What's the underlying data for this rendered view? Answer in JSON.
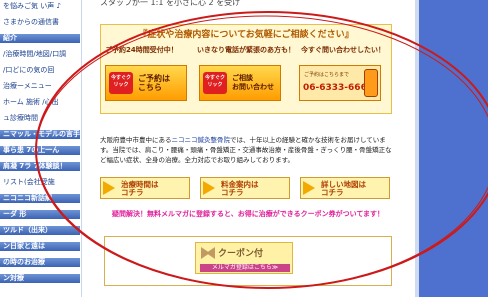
{
  "top_text": "スタッフが一 1:1 を小さに心  2 を受け",
  "sidebar": {
    "items": [
      {
        "label": "を悩みご気   い声 ♪",
        "kind": "link"
      },
      {
        "label": "さまからの通信書",
        "kind": "link"
      },
      {
        "label": "紹介",
        "kind": "head"
      },
      {
        "label": "/治療時間/地図/口調",
        "kind": "link"
      },
      {
        "label": "/口どにの気の回",
        "kind": "link"
      },
      {
        "label": "治療ーメニュー",
        "kind": "link"
      },
      {
        "label": "ホーム 施術 /心出",
        "kind": "link"
      },
      {
        "label": "ュ診療時間",
        "kind": "link"
      },
      {
        "label": "ニマッル・モデルの言手大",
        "kind": "head"
      },
      {
        "label": "事ら患 7の上一ん",
        "kind": "head"
      },
      {
        "label": "肩凝 7ラ 7体験談！",
        "kind": "head"
      },
      {
        "label": "リスト(会社受施",
        "kind": "link"
      },
      {
        "label": "ニコニコ新話解",
        "kind": "head"
      },
      {
        "label": "ーダ 形",
        "kind": "head"
      },
      {
        "label": "ツルド（出来）",
        "kind": "head"
      },
      {
        "label": "ン日家と遠は",
        "kind": "head"
      },
      {
        "label": "の時のお治療",
        "kind": "head"
      },
      {
        "label": "ン対療",
        "kind": "head"
      }
    ]
  },
  "banner": {
    "title": "『症状や治療内容についてお気軽にご相談ください』",
    "captions": [
      "ご予約24時間受付中！",
      "いきなり電話が緊張のあ方も！",
      "今すぐ問い合わせしたい！"
    ],
    "cta_reserve": {
      "badge": "今すぐクリック",
      "label": "ご予約は\nこちら"
    },
    "cta_consult": {
      "badge": "今すぐクリック",
      "label": "ご相談\nお問い合わせ"
    },
    "tel": {
      "small": "ご予約はこちらまで",
      "number": "06-6333-6665"
    }
  },
  "description": {
    "lead": "大阪府豊中市豊中にある",
    "clinic": "ニコニコ鍼灸整骨院",
    "body": "では、十年以上の経験と確かな技術をお届けしています。当院では、肩こり・腰痛・頭痛・骨盤矯正・交通事故治療・産後骨盤・ぎっくり腰・骨盤矯正など幅広い症状、全身の治療。全力対応でお取り組みしております。"
  },
  "buttons": [
    {
      "label": "治療時間は\nコチラ"
    },
    {
      "label": "料金案内は\nコチラ"
    },
    {
      "label": "詳しい地図は\nコチラ"
    }
  ],
  "promo": "疑問解決！無料メルマガに登録すると、お得に治療ができるクーポン券がついてます！",
  "coupon": {
    "title": "クーポン付",
    "subtitle": "メルマガ登録はこちら≫"
  },
  "colors": {
    "accent": "#4e71cf",
    "annotation": "#cc1a1a"
  }
}
